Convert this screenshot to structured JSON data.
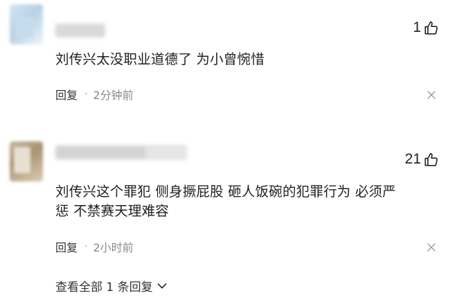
{
  "comments": [
    {
      "like_count": "1",
      "text": "刘传兴太没职业道德了 为小曾惋惜",
      "reply_label": "回复",
      "separator": "·",
      "time": "2分钟前"
    },
    {
      "like_count": "21",
      "text_line1": "刘传兴这个罪犯 侧身撅屁股 砸人饭碗的犯罪行为 必须严",
      "text_line2": "惩 不禁赛天理难容",
      "reply_label": "回复",
      "separator": "·",
      "time": "2小时前"
    }
  ],
  "view_replies_label": "查看全部 1 条回复",
  "icons": {
    "like": "thumb-up-icon",
    "close": "close-icon",
    "expand": "chevron-down-icon"
  },
  "colors": {
    "text": "#1f1f1f",
    "meta": "#8a8a8a",
    "background": "#ffffff"
  }
}
